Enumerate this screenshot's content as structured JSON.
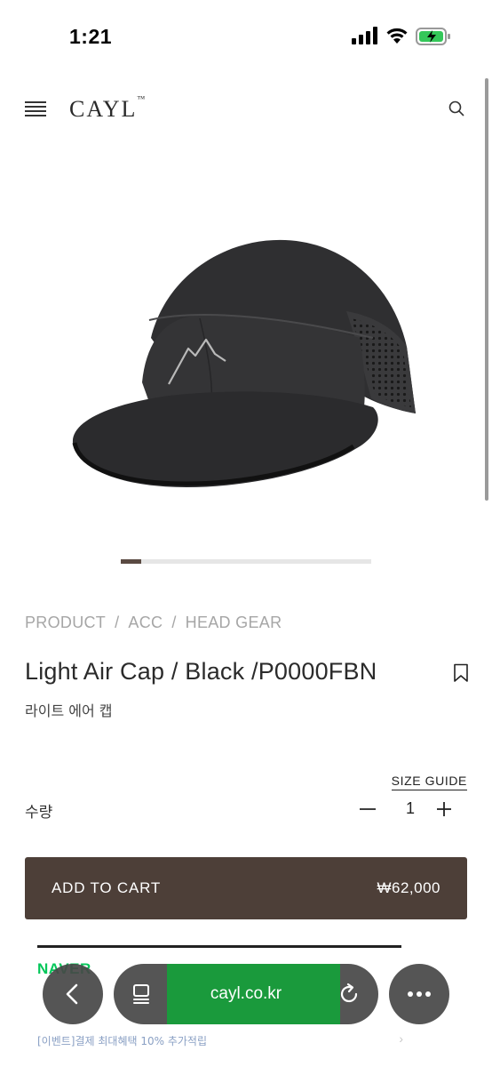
{
  "status_bar": {
    "time": "1:21"
  },
  "header": {
    "logo": "CAYL",
    "logo_mark": "™",
    "icons": {
      "menu": "hamburger-menu-icon",
      "search": "search-icon"
    }
  },
  "product": {
    "image_alt": "black five-panel cap with mountain logo",
    "carousel_progress": 0.08,
    "breadcrumb": [
      "PRODUCT",
      "ACC",
      "HEAD GEAR"
    ],
    "breadcrumb_separator": "/",
    "title": "Light Air Cap / Black /P0000FBN",
    "subtitle": "라이트 에어 캡",
    "size_guide": "SIZE GUIDE",
    "quantity_label": "수량",
    "quantity": "1",
    "add_to_cart": {
      "label": "ADD TO CART",
      "price": "₩62,000",
      "color": "#4d3f38"
    }
  },
  "naverpay": {
    "logo": "NAVER",
    "promo": "[이벤트]결제 최대혜택 10% 추가적립",
    "color": "#03c75a"
  },
  "browser": {
    "url": "cayl.co.kr",
    "icons": {
      "back": "chevron-left-icon",
      "tabs": "tabs-icon",
      "reload": "reload-icon",
      "more": "more-dots-icon"
    },
    "accent": "#1a9a3c"
  }
}
